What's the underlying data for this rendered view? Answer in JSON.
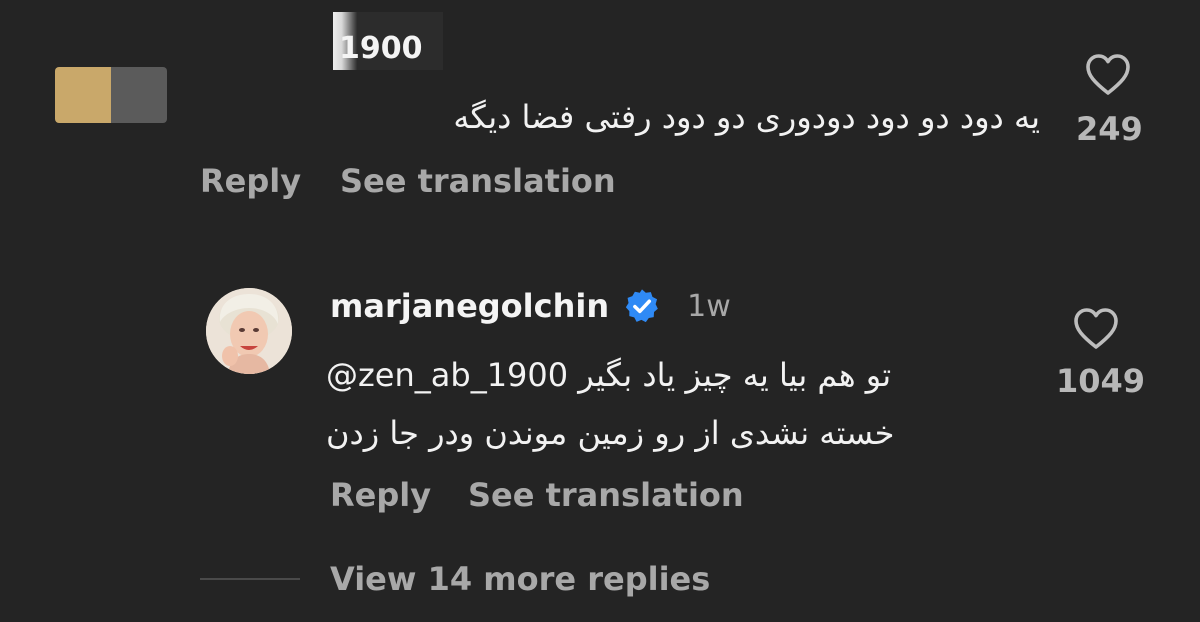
{
  "comment": {
    "username_partial": "1900",
    "text": "یه دود دو دود دودوری دو دود رفتی فضا دیگه",
    "likes": "249",
    "reply_label": "Reply",
    "translate_label": "See translation"
  },
  "reply": {
    "username": "marjanegolchin",
    "time": "1w",
    "mention": "@zen_ab_1900",
    "line1_text": "تو هم بیا یه چیز یاد بگیر",
    "line2_text": "خسته نشدی از رو زمین موندن ودر جا زدن",
    "likes": "1049",
    "reply_label": "Reply",
    "translate_label": "See translation",
    "verified_color": "#2f8af5"
  },
  "view_more": {
    "label": "View 14 more replies"
  },
  "colors": {
    "background": "#242424",
    "text": "#f2f2f2",
    "secondary_text": "#a8a8a8"
  }
}
